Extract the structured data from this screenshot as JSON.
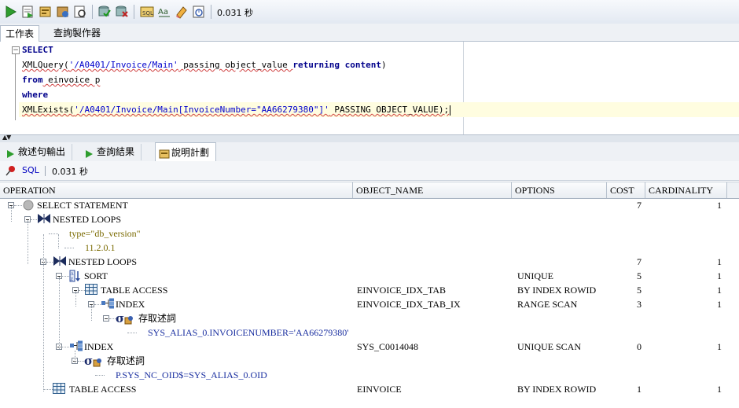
{
  "toolbar": {
    "icons": [
      "run-statement-icon",
      "run-script-icon",
      "explain-plan-icon",
      "autotrace-icon",
      "sql-tuning-icon",
      "commit-icon",
      "rollback-icon",
      "sql-history-icon",
      "format-text-icon",
      "clear-icon",
      "sql-monitor-icon"
    ],
    "timing": "0.031 秒"
  },
  "editor_tabs": [
    "工作表",
    "查詢製作器"
  ],
  "editor": {
    "lines": [
      [
        {
          "t": "SELECT",
          "k": "kw"
        }
      ],
      [
        {
          "t": "XMLQuery(",
          "k": ""
        },
        {
          "t": "'/A0401/Invoice/Main'",
          "k": "str"
        },
        {
          "t": " passing object_value ",
          "k": ""
        },
        {
          "t": "returning",
          "k": "kw"
        },
        {
          "t": " ",
          "k": ""
        },
        {
          "t": "content",
          "k": "kw"
        },
        {
          "t": ")",
          "k": ""
        }
      ],
      [
        {
          "t": "from",
          "k": "kw"
        },
        {
          "t": " einvoice p",
          "k": ""
        }
      ],
      [
        {
          "t": "where",
          "k": "kw"
        }
      ],
      [
        {
          "t": "XMLExists(",
          "k": ""
        },
        {
          "t": "'/A0401/Invoice/Main[InvoiceNumber=\"AA66279380\"]'",
          "k": "str"
        },
        {
          "t": " PASSING OBJECT_VALUE);",
          "k": ""
        }
      ]
    ]
  },
  "result_tabs": [
    "敘述句輸出",
    "查詢結果",
    "說明計劃"
  ],
  "result_bar": {
    "sql_label": "SQL",
    "timing": "0.031 秒"
  },
  "columns": [
    "OPERATION",
    "OBJECT_NAME",
    "OPTIONS",
    "COST",
    "CARDINALITY"
  ],
  "plan_rows": [
    {
      "op": "SELECT STATEMENT",
      "object": "",
      "options": "",
      "cost": "7",
      "card": "1",
      "icon": "select-statement-icon"
    },
    {
      "op": "NESTED LOOPS",
      "object": "",
      "options": "",
      "cost": "",
      "card": "",
      "icon": "nested-loops-icon"
    },
    {
      "op": "type=\"db_version\"",
      "object": "",
      "options": "",
      "cost": "",
      "card": "",
      "icon": ""
    },
    {
      "op": "11.2.0.1",
      "object": "",
      "options": "",
      "cost": "",
      "card": "",
      "icon": ""
    },
    {
      "op": "NESTED LOOPS",
      "object": "",
      "options": "",
      "cost": "7",
      "card": "1",
      "icon": "nested-loops-icon"
    },
    {
      "op": "SORT",
      "object": "",
      "options": "UNIQUE",
      "cost": "5",
      "card": "1",
      "icon": "sort-icon"
    },
    {
      "op": "TABLE ACCESS",
      "object": "EINVOICE_IDX_TAB",
      "options": "BY INDEX ROWID",
      "cost": "5",
      "card": "1",
      "icon": "table-access-icon"
    },
    {
      "op": "INDEX",
      "object": "EINVOICE_IDX_TAB_IX",
      "options": "RANGE SCAN",
      "cost": "3",
      "card": "1",
      "icon": "index-icon"
    },
    {
      "op": "存取述詞",
      "object": "",
      "options": "",
      "cost": "",
      "card": "",
      "icon": "access-predicate-icon"
    },
    {
      "op": "SYS_ALIAS_0.INVOICENUMBER='AA66279380'",
      "object": "",
      "options": "",
      "cost": "",
      "card": "",
      "icon": ""
    },
    {
      "op": "INDEX",
      "object": "SYS_C0014048",
      "options": "UNIQUE SCAN",
      "cost": "0",
      "card": "1",
      "icon": "index-icon"
    },
    {
      "op": "存取述詞",
      "object": "",
      "options": "",
      "cost": "",
      "card": "",
      "icon": "access-predicate-icon"
    },
    {
      "op": "P.SYS_NC_OID$=SYS_ALIAS_0.OID",
      "object": "",
      "options": "",
      "cost": "",
      "card": "",
      "icon": ""
    },
    {
      "op": "TABLE ACCESS",
      "object": "EINVOICE",
      "options": "BY INDEX ROWID",
      "cost": "1",
      "card": "1",
      "icon": "table-access-icon"
    }
  ]
}
